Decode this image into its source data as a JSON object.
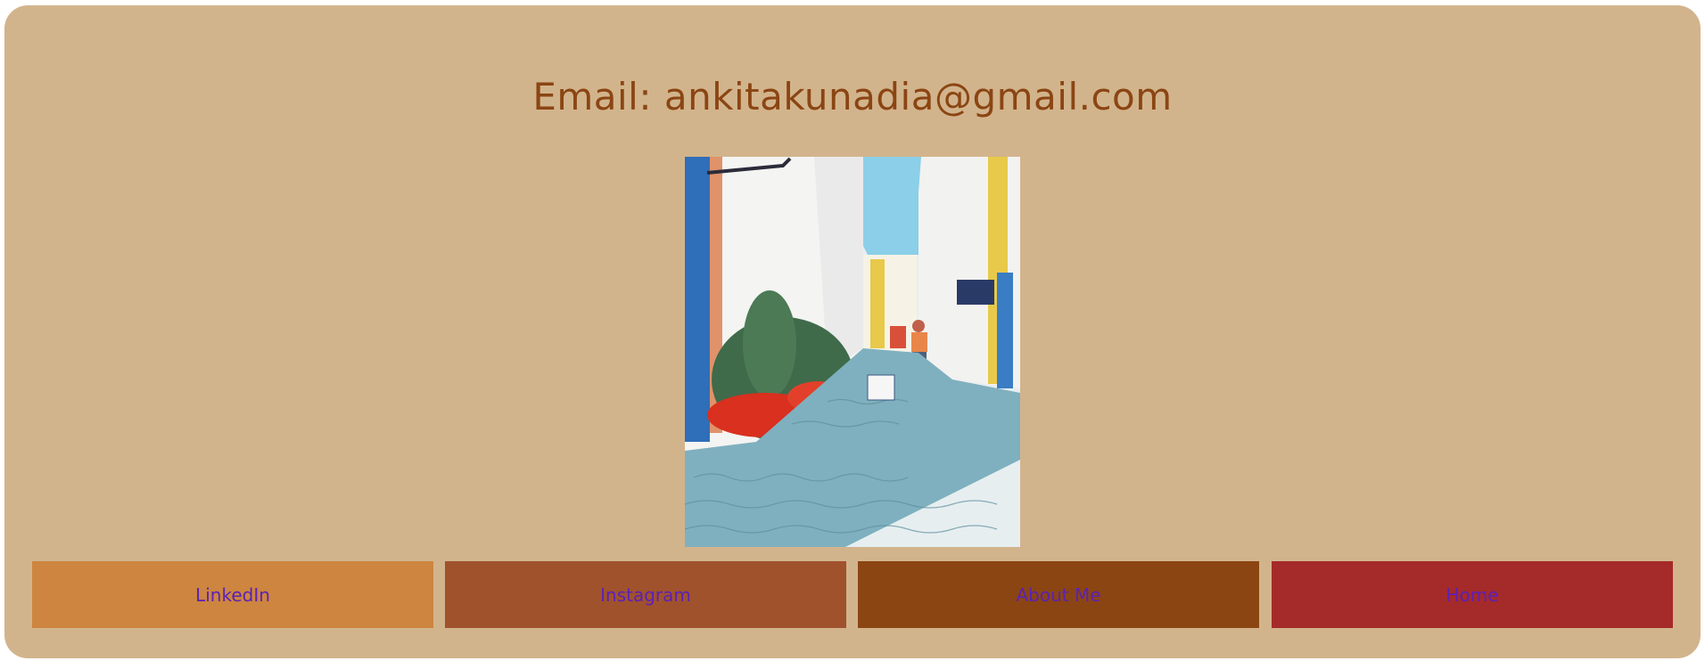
{
  "contact": {
    "email_text": "Email: ankitakunadia@gmail.com"
  },
  "photo": {
    "description_icon": "street-photo"
  },
  "nav": [
    {
      "label": "LinkedIn",
      "color": "#cd853f"
    },
    {
      "label": "Instagram",
      "color": "#a0522d"
    },
    {
      "label": "About Me",
      "color": "#8b4513"
    },
    {
      "label": "Home",
      "color": "#a52a2a"
    }
  ],
  "colors": {
    "card_bg": "#d2b48c",
    "email_text": "#8b4513",
    "nav_text": "#5b21b6"
  }
}
